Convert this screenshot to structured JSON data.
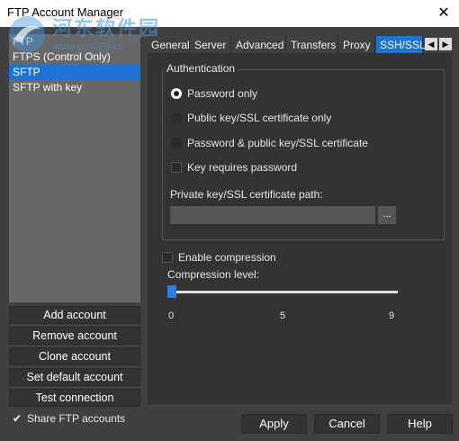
{
  "window": {
    "title": "FTP Account Manager",
    "close_glyph": "✕"
  },
  "watermark": {
    "site_name": "河东软件园",
    "url": "www.pc0359.cn"
  },
  "accounts": [
    {
      "label": "FTP",
      "selected": false
    },
    {
      "label": "FTPS (Control Only)",
      "selected": false
    },
    {
      "label": "SFTP",
      "selected": true
    },
    {
      "label": "SFTP with key",
      "selected": false
    }
  ],
  "side_buttons": {
    "add": "Add account",
    "remove": "Remove account",
    "clone": "Clone account",
    "set_default": "Set default account",
    "test": "Test connection"
  },
  "share": {
    "label": "Share FTP accounts",
    "checked": true,
    "check_glyph": "✔"
  },
  "tabs": [
    "General",
    "Server",
    "Advanced",
    "Transfers",
    "Proxy",
    "SSH/SSL"
  ],
  "active_tab": "SSH/SSL",
  "tab_scroll": {
    "left": "◀",
    "right": "▶"
  },
  "auth": {
    "legend": "Authentication",
    "options": [
      "Password only",
      "Public key/SSL certificate only",
      "Password & public key/SSL certificate"
    ],
    "selected_option": "Password only",
    "key_requires_password": {
      "label": "Key requires password",
      "checked": false
    },
    "path_label": "Private key/SSL certificate path:",
    "path_value": "",
    "browse_label": "..."
  },
  "compression": {
    "enable_label": "Enable compression",
    "enabled": false,
    "level_label": "Compression level:",
    "level": 0,
    "ticks": [
      "0",
      "5",
      "9"
    ]
  },
  "bottom_buttons": {
    "apply": "Apply",
    "cancel": "Cancel",
    "help": "Help"
  },
  "colors": {
    "accent": "#1e73d2",
    "background": "#404040",
    "panel": "#333333"
  }
}
